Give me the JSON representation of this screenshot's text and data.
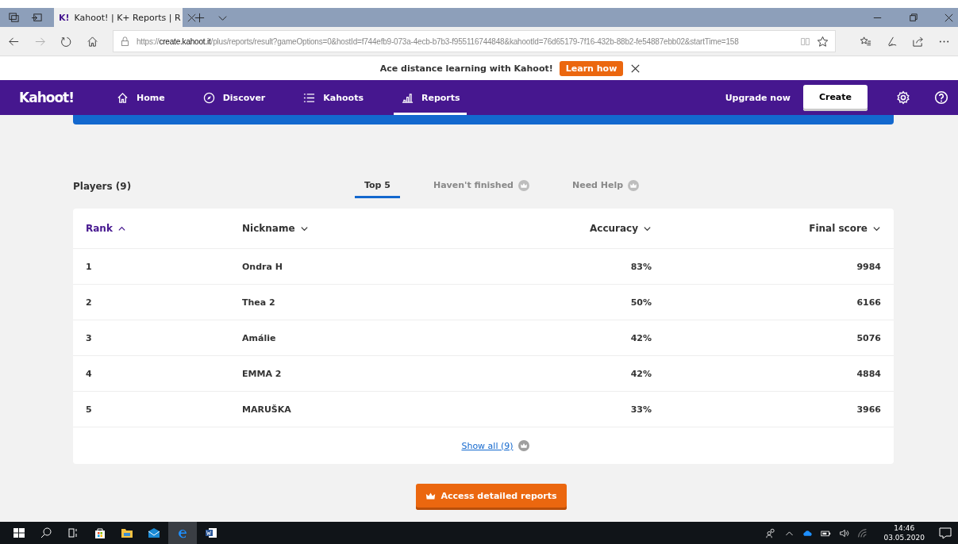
{
  "browser": {
    "favicon": "K!",
    "tab_title": "Kahoot! | K+ Reports | R",
    "url_scheme": "https://",
    "url_host": "create.kahoot.it",
    "url_path": "/plus/reports/result?gameOptions=0&hostId=f744efb9-073a-4ecb-b7b3-f955116744848&kahootId=76d65179-7f16-432b-88b2-fe54887ebb02&startTime=158"
  },
  "banner": {
    "text": "Ace distance learning with Kahoot!",
    "button": "Learn how"
  },
  "nav": {
    "logo": "Kahoot!",
    "items": [
      {
        "label": "Home",
        "kind": "home",
        "selected": false
      },
      {
        "label": "Discover",
        "kind": "discover",
        "selected": false
      },
      {
        "label": "Kahoots",
        "kind": "kahoots",
        "selected": false
      },
      {
        "label": "Reports",
        "kind": "reports",
        "selected": true
      }
    ],
    "upgrade": "Upgrade now",
    "create": "Create"
  },
  "players": {
    "title": "Players (9)",
    "tabs": [
      {
        "label": "Top 5",
        "selected": true,
        "locked": false
      },
      {
        "label": "Haven't finished",
        "selected": false,
        "locked": true
      },
      {
        "label": "Need Help",
        "selected": false,
        "locked": true
      }
    ]
  },
  "table": {
    "columns": [
      {
        "label": "Rank",
        "ascending": true,
        "active": true
      },
      {
        "label": "Nickname",
        "ascending": false,
        "active": false
      },
      {
        "label": "Accuracy",
        "ascending": false,
        "active": false
      },
      {
        "label": "Final score",
        "ascending": false,
        "active": false
      }
    ],
    "rows": [
      [
        "1",
        "Ondra H",
        "83%",
        "9984"
      ],
      [
        "2",
        "Thea 2",
        "50%",
        "6166"
      ],
      [
        "3",
        "Amálie",
        "42%",
        "5076"
      ],
      [
        "4",
        "EMMA 2",
        "42%",
        "4884"
      ],
      [
        "5",
        "MARUŠKA",
        "33%",
        "3966"
      ]
    ],
    "show_all": "Show all (9)"
  },
  "detailed_button": "Access detailed reports",
  "taskbar": {
    "time": "14:46",
    "date": "03.05.2020"
  }
}
